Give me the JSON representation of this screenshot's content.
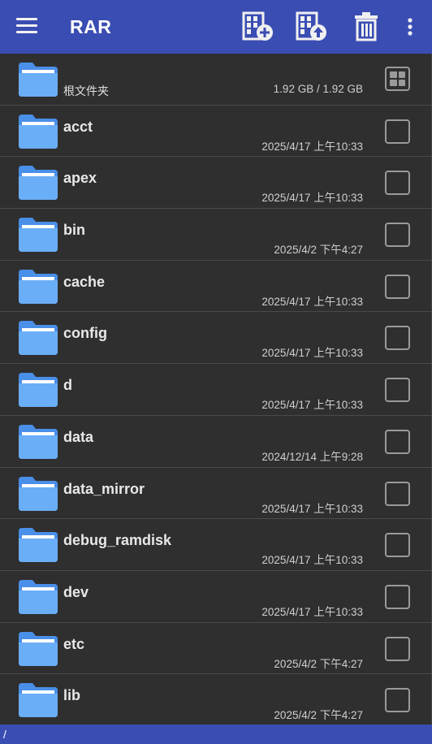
{
  "app": {
    "title": "RAR"
  },
  "toolbar": {
    "colors": {
      "bar": "#3a4db3",
      "icon": "#f0f0f0"
    },
    "icons": [
      "menu-icon",
      "add-to-archive-icon",
      "extract-archive-icon",
      "trash-icon",
      "more-vert-icon"
    ]
  },
  "root": {
    "label": "根文件夹",
    "storage": "1.92 GB / 1.92 GB"
  },
  "folders": [
    {
      "name": "acct",
      "date": "2025/4/17 上午10:33"
    },
    {
      "name": "apex",
      "date": "2025/4/17 上午10:33"
    },
    {
      "name": "bin",
      "date": "2025/4/2 下午4:27"
    },
    {
      "name": "cache",
      "date": "2025/4/17 上午10:33"
    },
    {
      "name": "config",
      "date": "2025/4/17 上午10:33"
    },
    {
      "name": "d",
      "date": "2025/4/17 上午10:33"
    },
    {
      "name": "data",
      "date": "2024/12/14 上午9:28"
    },
    {
      "name": "data_mirror",
      "date": "2025/4/17 上午10:33"
    },
    {
      "name": "debug_ramdisk",
      "date": "2025/4/17 上午10:33"
    },
    {
      "name": "dev",
      "date": "2025/4/17 上午10:33"
    },
    {
      "name": "etc",
      "date": "2025/4/2 下午4:27"
    },
    {
      "name": "lib",
      "date": "2025/4/2 下午4:27"
    }
  ],
  "status": {
    "path": "/"
  }
}
